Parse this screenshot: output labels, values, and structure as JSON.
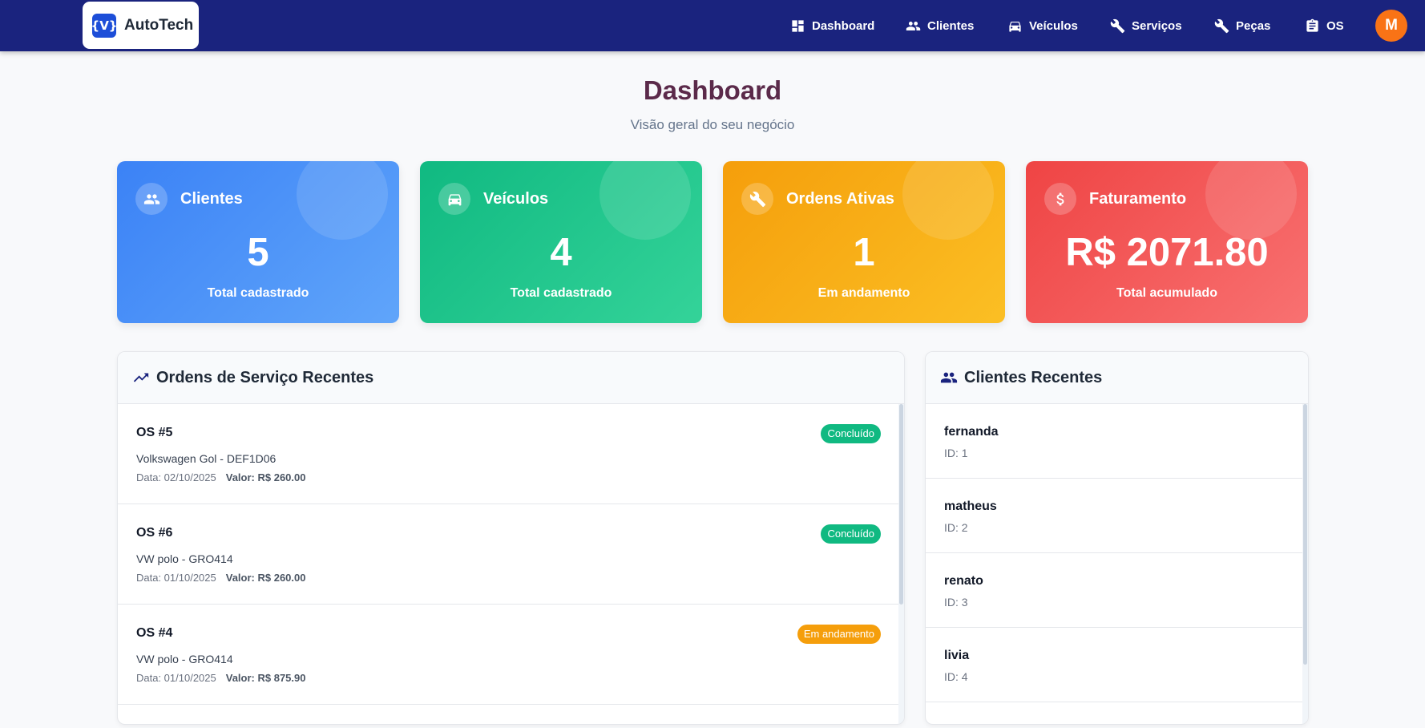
{
  "brand": {
    "logo": "{V}",
    "name": "AutoTech"
  },
  "nav": [
    {
      "label": "Dashboard",
      "icon": "dashboard-icon"
    },
    {
      "label": "Clientes",
      "icon": "people-icon"
    },
    {
      "label": "Veículos",
      "icon": "car-icon"
    },
    {
      "label": "Serviços",
      "icon": "wrench-icon"
    },
    {
      "label": "Peças",
      "icon": "wrench-icon"
    },
    {
      "label": "OS",
      "icon": "clipboard-icon"
    }
  ],
  "user": {
    "initial": "M",
    "color": "#f97316"
  },
  "header": {
    "title": "Dashboard",
    "subtitle": "Visão geral do seu negócio"
  },
  "stats": [
    {
      "label": "Clientes",
      "value": "5",
      "caption": "Total cadastrado",
      "icon": "people-icon",
      "color": "#3b82f6"
    },
    {
      "label": "Veículos",
      "value": "4",
      "caption": "Total cadastrado",
      "icon": "car-icon",
      "color": "#10b981"
    },
    {
      "label": "Ordens Ativas",
      "value": "1",
      "caption": "Em andamento",
      "icon": "wrench-icon",
      "color": "#f59e0b"
    },
    {
      "label": "Faturamento",
      "value": "R$ 2071.80",
      "caption": "Total acumulado",
      "icon": "dollar-icon",
      "color": "#ef4444"
    }
  ],
  "orders_panel": {
    "title": "Ordens de Serviço Recentes",
    "items": [
      {
        "id": "OS #5",
        "vehicle": "Volkswagen Gol - DEF1D06",
        "date": "Data: 02/10/2025",
        "value": "Valor: R$ 260.00",
        "status": "Concluído",
        "status_color": "#10b981"
      },
      {
        "id": "OS #6",
        "vehicle": "VW polo - GRO414",
        "date": "Data: 01/10/2025",
        "value": "Valor: R$ 260.00",
        "status": "Concluído",
        "status_color": "#10b981"
      },
      {
        "id": "OS #4",
        "vehicle": "VW polo - GRO414",
        "date": "Data: 01/10/2025",
        "value": "Valor: R$ 875.90",
        "status": "Em andamento",
        "status_color": "#f59e0b"
      }
    ]
  },
  "clients_panel": {
    "title": "Clientes Recentes",
    "items": [
      {
        "name": "fernanda",
        "id": "ID: 1"
      },
      {
        "name": "matheus",
        "id": "ID: 2"
      },
      {
        "name": "renato",
        "id": "ID: 3"
      },
      {
        "name": "livia",
        "id": "ID: 4"
      }
    ]
  }
}
